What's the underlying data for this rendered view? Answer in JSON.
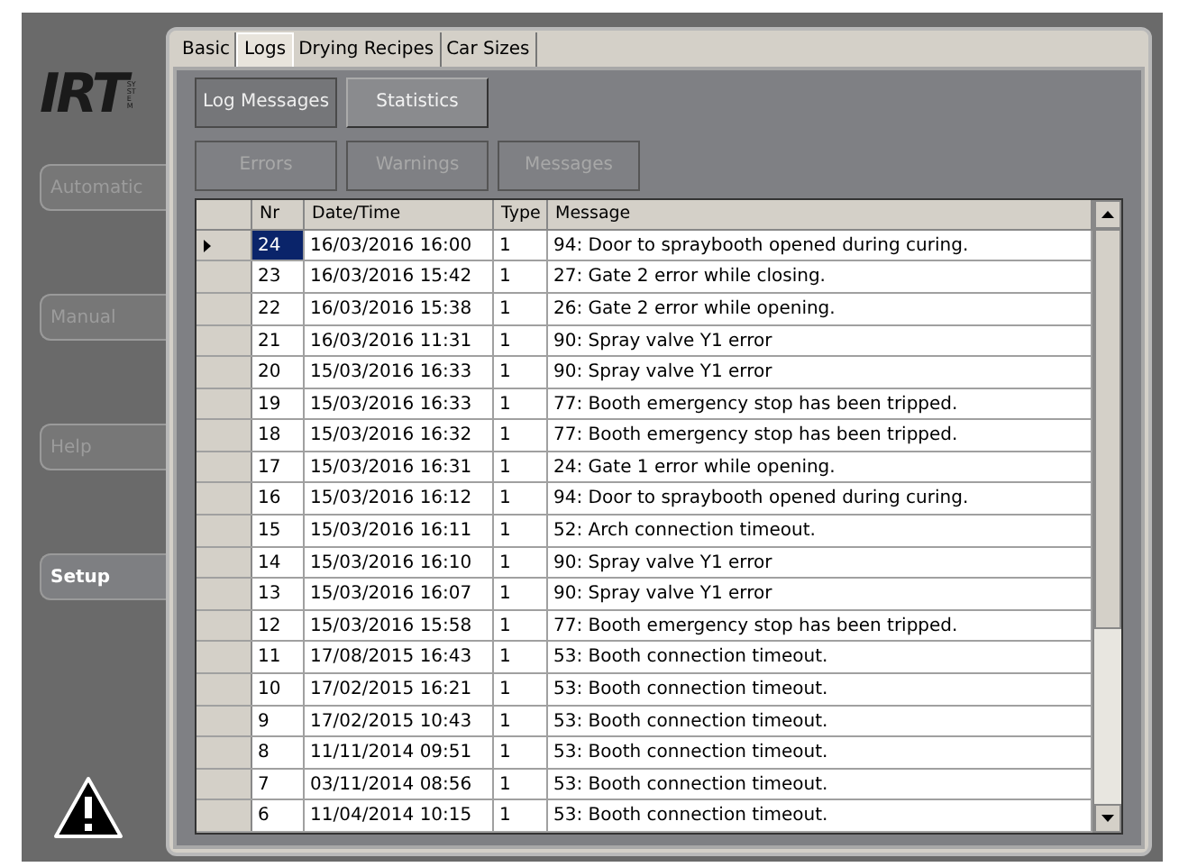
{
  "logo": {
    "text": "IRT",
    "subtext": "SYSTEM"
  },
  "nav": [
    {
      "label": "Automatic",
      "selected": false,
      "disabled": true
    },
    {
      "label": "Manual",
      "selected": false,
      "disabled": true
    },
    {
      "label": "Help",
      "selected": false,
      "disabled": true
    },
    {
      "label": "Setup",
      "selected": true,
      "disabled": false
    }
  ],
  "tabs": [
    {
      "label": "Basic",
      "selected": false
    },
    {
      "label": "Logs",
      "selected": true
    },
    {
      "label": "Drying Recipes",
      "selected": false
    },
    {
      "label": "Car Sizes",
      "selected": false
    }
  ],
  "view_buttons": [
    {
      "label": "Log Messages",
      "selected": true
    },
    {
      "label": "Statistics",
      "selected": false
    }
  ],
  "filter_buttons": [
    {
      "label": "Errors",
      "disabled": true
    },
    {
      "label": "Warnings",
      "disabled": true
    },
    {
      "label": "Messages",
      "disabled": true
    }
  ],
  "table": {
    "columns": [
      "Nr",
      "Date/Time",
      "Type",
      "Message"
    ],
    "rows": [
      {
        "cells": [
          "24",
          "16/03/2016 16:00",
          "1",
          "94: Door to spraybooth opened during curing."
        ],
        "selected": true
      },
      {
        "cells": [
          "23",
          "16/03/2016 15:42",
          "1",
          "27: Gate 2 error while closing."
        ],
        "selected": false
      },
      {
        "cells": [
          "22",
          "16/03/2016 15:38",
          "1",
          "26: Gate 2 error while opening."
        ],
        "selected": false
      },
      {
        "cells": [
          "21",
          "16/03/2016 11:31",
          "1",
          "90: Spray valve Y1 error"
        ],
        "selected": false
      },
      {
        "cells": [
          "20",
          "15/03/2016 16:33",
          "1",
          "90: Spray valve Y1 error"
        ],
        "selected": false
      },
      {
        "cells": [
          "19",
          "15/03/2016 16:33",
          "1",
          "77: Booth emergency stop has been tripped."
        ],
        "selected": false
      },
      {
        "cells": [
          "18",
          "15/03/2016 16:32",
          "1",
          "77: Booth emergency stop has been tripped."
        ],
        "selected": false
      },
      {
        "cells": [
          "17",
          "15/03/2016 16:31",
          "1",
          "24: Gate 1 error while opening."
        ],
        "selected": false
      },
      {
        "cells": [
          "16",
          "15/03/2016 16:12",
          "1",
          "94: Door to spraybooth opened during curing."
        ],
        "selected": false
      },
      {
        "cells": [
          "15",
          "15/03/2016 16:11",
          "1",
          "52: Arch connection timeout."
        ],
        "selected": false
      },
      {
        "cells": [
          "14",
          "15/03/2016 16:10",
          "1",
          "90: Spray valve Y1 error"
        ],
        "selected": false
      },
      {
        "cells": [
          "13",
          "15/03/2016 16:07",
          "1",
          "90: Spray valve Y1 error"
        ],
        "selected": false
      },
      {
        "cells": [
          "12",
          "15/03/2016 15:58",
          "1",
          "77: Booth emergency stop has been tripped."
        ],
        "selected": false
      },
      {
        "cells": [
          "11",
          "17/08/2015 16:43",
          "1",
          "53: Booth connection timeout."
        ],
        "selected": false
      },
      {
        "cells": [
          "10",
          "17/02/2015 16:21",
          "1",
          "53: Booth connection timeout."
        ],
        "selected": false
      },
      {
        "cells": [
          "9",
          "17/02/2015 10:43",
          "1",
          "53: Booth connection timeout."
        ],
        "selected": false
      },
      {
        "cells": [
          "8",
          "11/11/2014 09:51",
          "1",
          "53: Booth connection timeout."
        ],
        "selected": false
      },
      {
        "cells": [
          "7",
          "03/11/2014 08:56",
          "1",
          "53: Booth connection timeout."
        ],
        "selected": false
      },
      {
        "cells": [
          "6",
          "11/04/2014 10:15",
          "1",
          "53: Booth connection timeout."
        ],
        "selected": false
      }
    ]
  }
}
